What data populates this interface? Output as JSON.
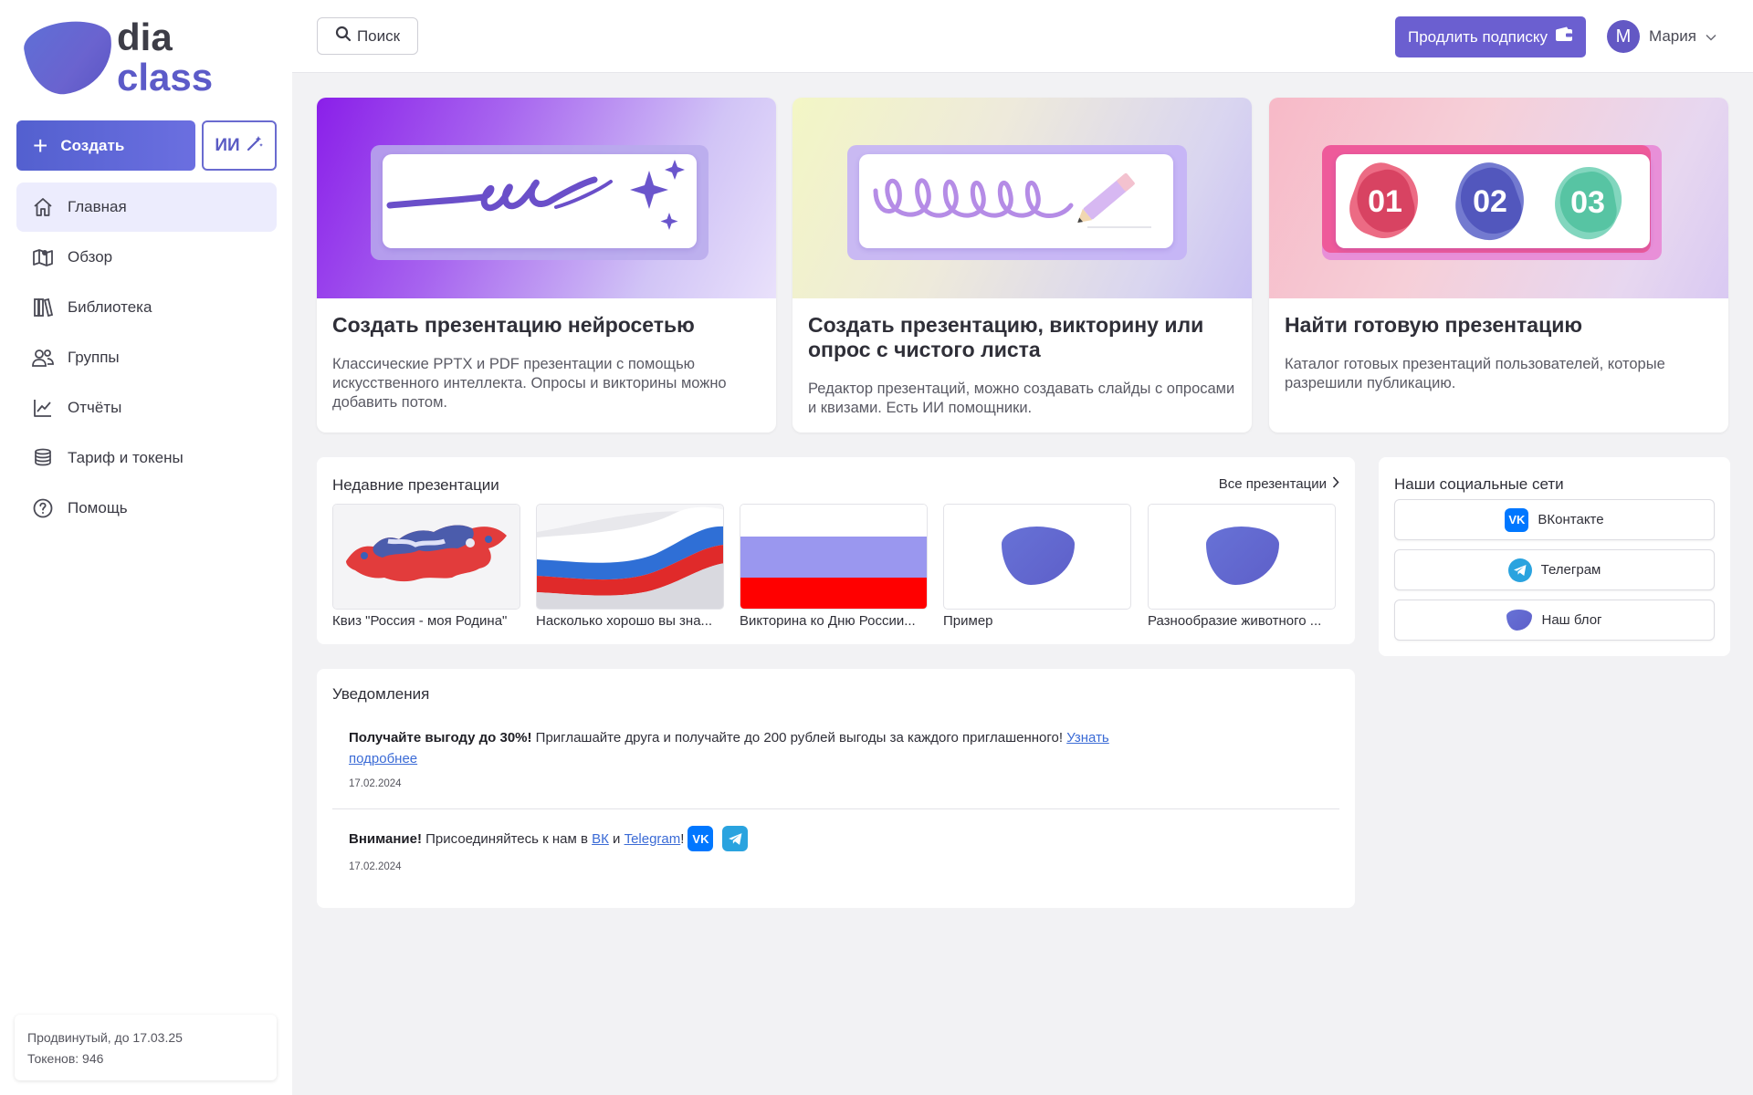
{
  "brand": {
    "line1": "dia",
    "line2": "class"
  },
  "sidebar": {
    "create_label": "Создать",
    "ai_label": "ИИ",
    "items": [
      {
        "label": "Главная",
        "icon": "home-icon",
        "active": true
      },
      {
        "label": "Обзор",
        "icon": "map-icon"
      },
      {
        "label": "Библиотека",
        "icon": "library-icon"
      },
      {
        "label": "Группы",
        "icon": "users-icon"
      },
      {
        "label": "Отчёты",
        "icon": "chart-icon"
      },
      {
        "label": "Тариф и токены",
        "icon": "coins-icon"
      },
      {
        "label": "Помощь",
        "icon": "help-icon"
      }
    ],
    "plan": {
      "line1": "Продвинутый, до 17.03.25",
      "line2": "Токенов: 946"
    }
  },
  "topbar": {
    "search_label": "Поиск",
    "renew_label": "Продлить подписку",
    "user_initial": "М",
    "user_name": "Мария"
  },
  "cards": [
    {
      "title": "Создать презентацию нейросетью",
      "desc": "Классические PPTX и PDF презентации с помощью искусственного интеллекта. Опросы и викторины можно добавить потом."
    },
    {
      "title": "Создать презентацию, викторину или опрос с чистого листа",
      "desc": "Редактор презентаций, можно создавать слайды с опросами и квизами. Есть ИИ помощники."
    },
    {
      "title": "Найти готовую презентацию",
      "desc": "Каталог готовых презентаций пользователей, которые разрешили публикацию.",
      "steps": [
        "01",
        "02",
        "03"
      ]
    }
  ],
  "recent": {
    "title": "Недавние презентации",
    "all_label": "Все презентации",
    "items": [
      {
        "label": "Квиз \"Россия - моя Родина\""
      },
      {
        "label": "Насколько хорошо вы зна..."
      },
      {
        "label": "Викторина ко Дню России..."
      },
      {
        "label": "Пример"
      },
      {
        "label": "Разнообразие животного ..."
      }
    ]
  },
  "social": {
    "title": "Наши социальные сети",
    "vk_badge": "VK",
    "items": [
      {
        "label": "ВКонтакте"
      },
      {
        "label": "Телеграм"
      },
      {
        "label": "Наш блог"
      }
    ]
  },
  "notifications": {
    "title": "Уведомления",
    "items": [
      {
        "bold": "Получайте выгоду до 30%!",
        "text": " Приглашайте друга и получайте до 200 рублей выгоды за каждого приглашенного! ",
        "link": "Узнать подробнее",
        "date": "17.02.2024"
      },
      {
        "bold": "Внимание!",
        "text1": " Присоединяйтесь к нам в ",
        "link1": "ВК",
        "text2": " и ",
        "link2": "Telegram",
        "text3": "!",
        "date": "17.02.2024"
      }
    ]
  },
  "colors": {
    "accent": "#6b5fd0",
    "brand_blue": "#5c5bc8",
    "active_nav_bg": "#ececfd",
    "vk": "#0077ff",
    "telegram": "#2aa3df"
  }
}
